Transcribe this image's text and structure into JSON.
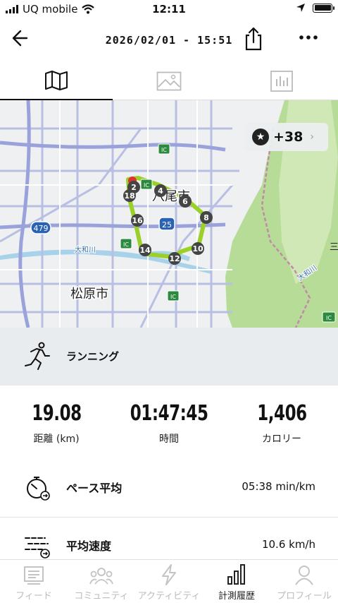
{
  "status_bar": {
    "carrier": "UQ mobile",
    "time": "12:11"
  },
  "nav": {
    "title": "2026/02/01 - 15:51"
  },
  "tabs": [
    {
      "name": "map",
      "icon": "map-icon",
      "active": true
    },
    {
      "name": "photo",
      "icon": "image-icon",
      "active": false
    },
    {
      "name": "chart",
      "icon": "bar-chart-icon",
      "active": false
    }
  ],
  "map": {
    "labels": {
      "city_yao": "八尾市",
      "city_matsubara": "松原市",
      "river": "大和川",
      "river2": "大和川",
      "place_right": "三"
    },
    "road_shields": {
      "r479": "479",
      "r25": "25",
      "ic": "IC"
    },
    "km_markers": [
      "2",
      "4",
      "6",
      "8",
      "10",
      "12",
      "14",
      "16",
      "18"
    ],
    "achievements": {
      "count": "+38"
    }
  },
  "activity": {
    "type": "ランニング"
  },
  "stats": {
    "distance": {
      "value": "19.08",
      "label": "距離 (km)"
    },
    "time": {
      "value": "01:47:45",
      "label": "時間"
    },
    "calories": {
      "value": "1,406",
      "label": "カロリー"
    }
  },
  "metrics": [
    {
      "label": "ペース平均",
      "value": "05:38 min/km"
    },
    {
      "label": "平均速度",
      "value": "10.6 km/h"
    }
  ],
  "bottom_nav": [
    {
      "label": "フィード",
      "active": false
    },
    {
      "label": "コミュニティ",
      "active": false
    },
    {
      "label": "アクティビティ",
      "active": false
    },
    {
      "label": "計測履歴",
      "active": true
    },
    {
      "label": "プロフィール",
      "active": false
    }
  ]
}
